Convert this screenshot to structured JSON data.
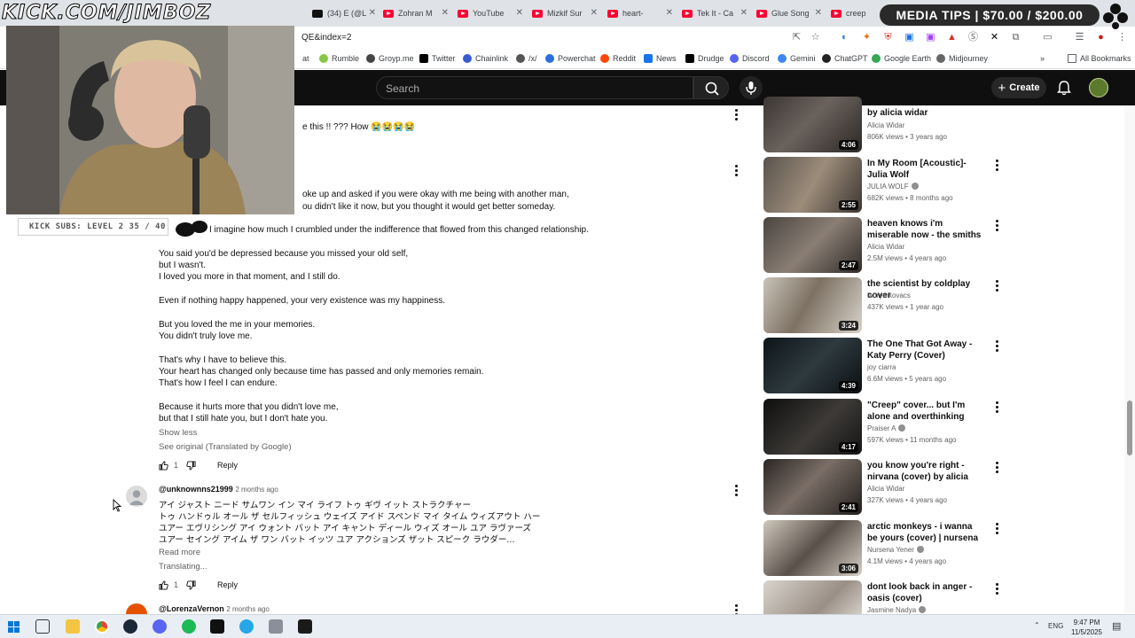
{
  "browser": {
    "tabs": [
      {
        "label": "(34) E (@L",
        "favicon": "x-icon"
      },
      {
        "label": "Zohran M",
        "favicon": "youtube-icon"
      },
      {
        "label": "YouTube",
        "favicon": "youtube-icon"
      },
      {
        "label": "Mizkif Sur",
        "favicon": "youtube-icon"
      },
      {
        "label": "heart-",
        "favicon": "youtube-icon"
      },
      {
        "label": "Tek It - Ca",
        "favicon": "youtube-icon"
      },
      {
        "label": "Glue Song",
        "favicon": "youtube-icon"
      },
      {
        "label": "creep",
        "favicon": "youtube-icon"
      }
    ],
    "url_fragment": "QE&index=2",
    "bookmarks": [
      "at",
      "Rumble",
      "Groyp.me",
      "Twitter",
      "Chainlink",
      "/x/",
      "Powerchat",
      "Reddit",
      "News",
      "Drudge",
      "Discord",
      "Gemini",
      "ChatGPT",
      "Google Earth",
      "Midjourney"
    ],
    "all_bookmarks_label": "All Bookmarks"
  },
  "youtube": {
    "search_placeholder": "Search",
    "create_label": "Create"
  },
  "overlay": {
    "watermark": "KICK.COM/JIMBOZ",
    "subs_bar": "KICK SUBS: LEVEL 2 35 / 40",
    "media_tips": "MEDIA TIPS  |  $70.00 / $200.00"
  },
  "comments": {
    "partial_first_line": "e this !! ??? How 😭😭😭😭",
    "second": {
      "lines": [
        "oke up and asked if you were okay with me being with another man,",
        "ou didn't like it now, but you thought it would get better someday.",
        "I imagine how much I crumbled under the indifference that flowed from this changed relationship.",
        "You said you'd be depressed because you missed your old self,",
        "but I wasn't.",
        "I loved you more in that moment, and I still do.",
        "Even if nothing happy happened, your very existence was my happiness.",
        "But you loved the me in your memories.",
        "You didn't truly love me.",
        "That's why I have to believe this.",
        "Your heart has changed only because time has passed and only memories remain.",
        "That's how I feel I can endure.",
        "Because it hurts more that you didn't love me,",
        "but that I still hate you, but I don't hate you."
      ],
      "show_less": "Show less",
      "see_original": "See original (Translated by Google)",
      "likes": "1",
      "reply": "Reply"
    },
    "third": {
      "author": "@unknownns21999",
      "time": "2 months ago",
      "lines": [
        "アイ ジャスト ニード サムワン イン マイ ライフ トゥ ギヴ イット ストラクチャー",
        "トゥ ハンドゥル オール ザ セルフィッシュ ウェイズ アイド スペンド マイ タイム ウィズアウト ハー",
        "ユアー エヴリシング アイ ウォント バット アイ キャント ディール ウィズ オール ユア ラヴァーズ",
        "ユアー セイング アイム ザ ワン バット イッツ ユア アクションズ ザット スピーク ラウダー..."
      ],
      "read_more": "Read more",
      "translating": "Translating...",
      "likes": "1",
      "reply": "Reply"
    },
    "fourth": {
      "author": "@LorenzaVernon",
      "time": "2 months ago"
    }
  },
  "sidebar_videos": [
    {
      "title": "by alicia widar",
      "channel": "Alicia Widar",
      "meta": "806K views • 3 years ago",
      "duration": "4:06",
      "verified": false
    },
    {
      "title": "In My Room [Acoustic]- Julia Wolf",
      "channel": "JULIA WOLF",
      "meta": "682K views • 8 months ago",
      "duration": "2:55",
      "verified": true
    },
    {
      "title": "heaven knows i'm miserable now - the smiths (cover) by ...",
      "channel": "Alicia Widar",
      "meta": "2.5M views • 4 years ago",
      "duration": "2:47",
      "verified": false
    },
    {
      "title": "the scientist by coldplay cover",
      "channel": "lauryn kovacs",
      "meta": "437K views • 1 year ago",
      "duration": "3:24",
      "verified": false
    },
    {
      "title": "The One That Got Away - Katy Perry (Cover)",
      "channel": "joy ciarra",
      "meta": "6.6M views • 5 years ago",
      "duration": "4:39",
      "verified": false
    },
    {
      "title": "\"Creep\" cover... but I'm alone and overthinking",
      "channel": "Praiser A",
      "meta": "597K views • 11 months ago",
      "duration": "4:17",
      "verified": true
    },
    {
      "title": "you know you're right - nirvana (cover) by alicia widar",
      "channel": "Alicia Widar",
      "meta": "327K views • 4 years ago",
      "duration": "2:41",
      "verified": false
    },
    {
      "title": "arctic monkeys - i wanna be yours (cover) | nursena yener",
      "channel": "Nursena Yener",
      "meta": "4.1M views • 4 years ago",
      "duration": "3:06",
      "verified": true
    },
    {
      "title": "dont look back in anger - oasis (cover)",
      "channel": "Jasmine Nadya",
      "meta": "",
      "duration": "",
      "verified": true
    }
  ],
  "taskbar": {
    "lang": "ENG",
    "time": "9:47 PM",
    "date": "11/5/2025"
  }
}
